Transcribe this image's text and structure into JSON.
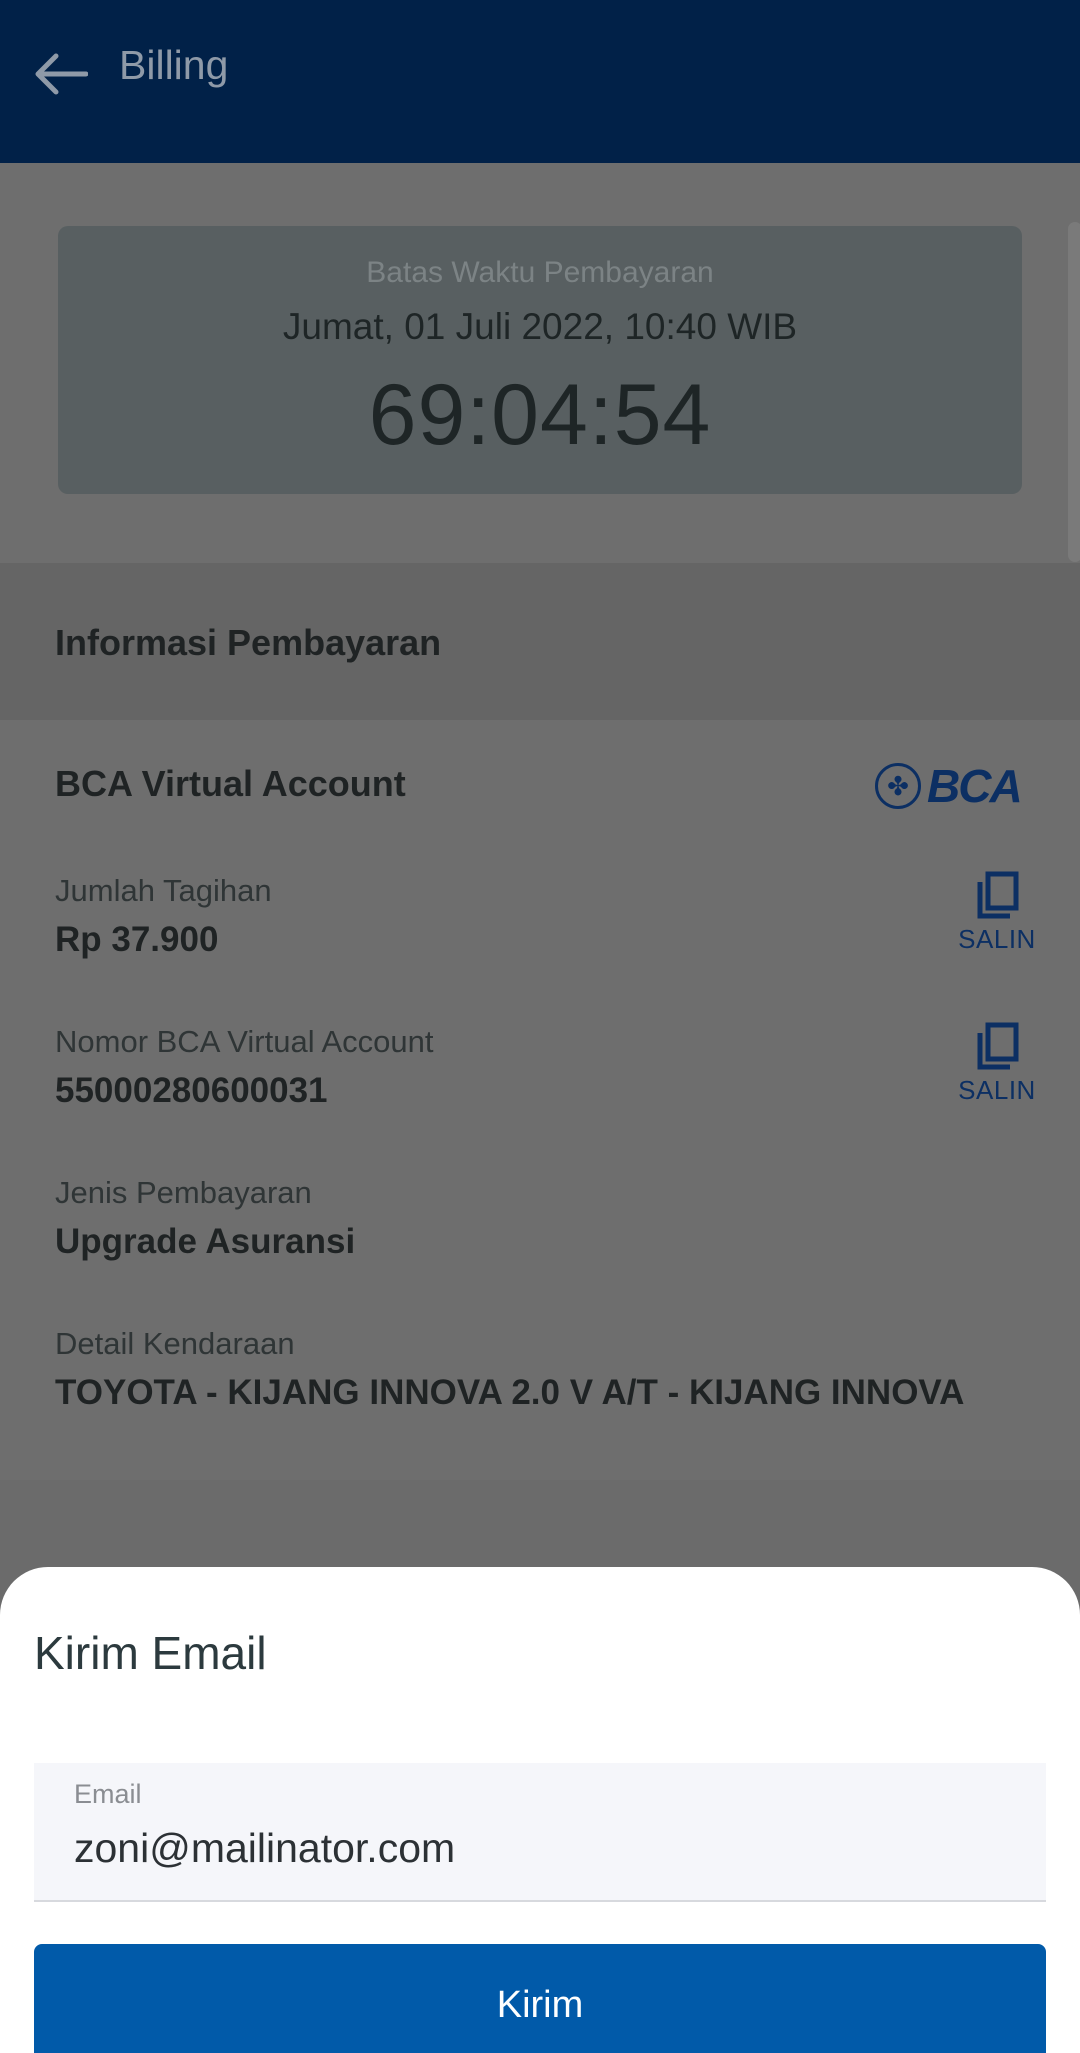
{
  "header": {
    "title": "Billing",
    "back_icon": "arrow-left-icon"
  },
  "deadline": {
    "label": "Batas Waktu Pembayaran",
    "date": "Jumat, 01 Juli 2022, 10:40 WIB",
    "countdown": "69:04:54"
  },
  "payment_info": {
    "section_title": "Informasi Pembayaran",
    "bank_name": "BCA Virtual Account",
    "bank_logo_text": "BCA",
    "fields": [
      {
        "label": "Jumlah Tagihan",
        "value": "Rp 37.900",
        "copy_label": "SALIN"
      },
      {
        "label": "Nomor BCA Virtual Account",
        "value": "55000280600031",
        "copy_label": "SALIN"
      },
      {
        "label": "Jenis Pembayaran",
        "value": "Upgrade Asuransi"
      },
      {
        "label": "Detail Kendaraan",
        "value": "TOYOTA - KIJANG INNOVA 2.0 V A/T - KIJANG INNOVA"
      }
    ]
  },
  "email_sheet": {
    "title": "Kirim Email",
    "email_label": "Email",
    "email_value": "zoni@mailinator.com",
    "submit_label": "Kirim"
  },
  "colors": {
    "appbar": "#012148",
    "primary_button": "#015aa9",
    "overlay": "#6b6b6b"
  }
}
